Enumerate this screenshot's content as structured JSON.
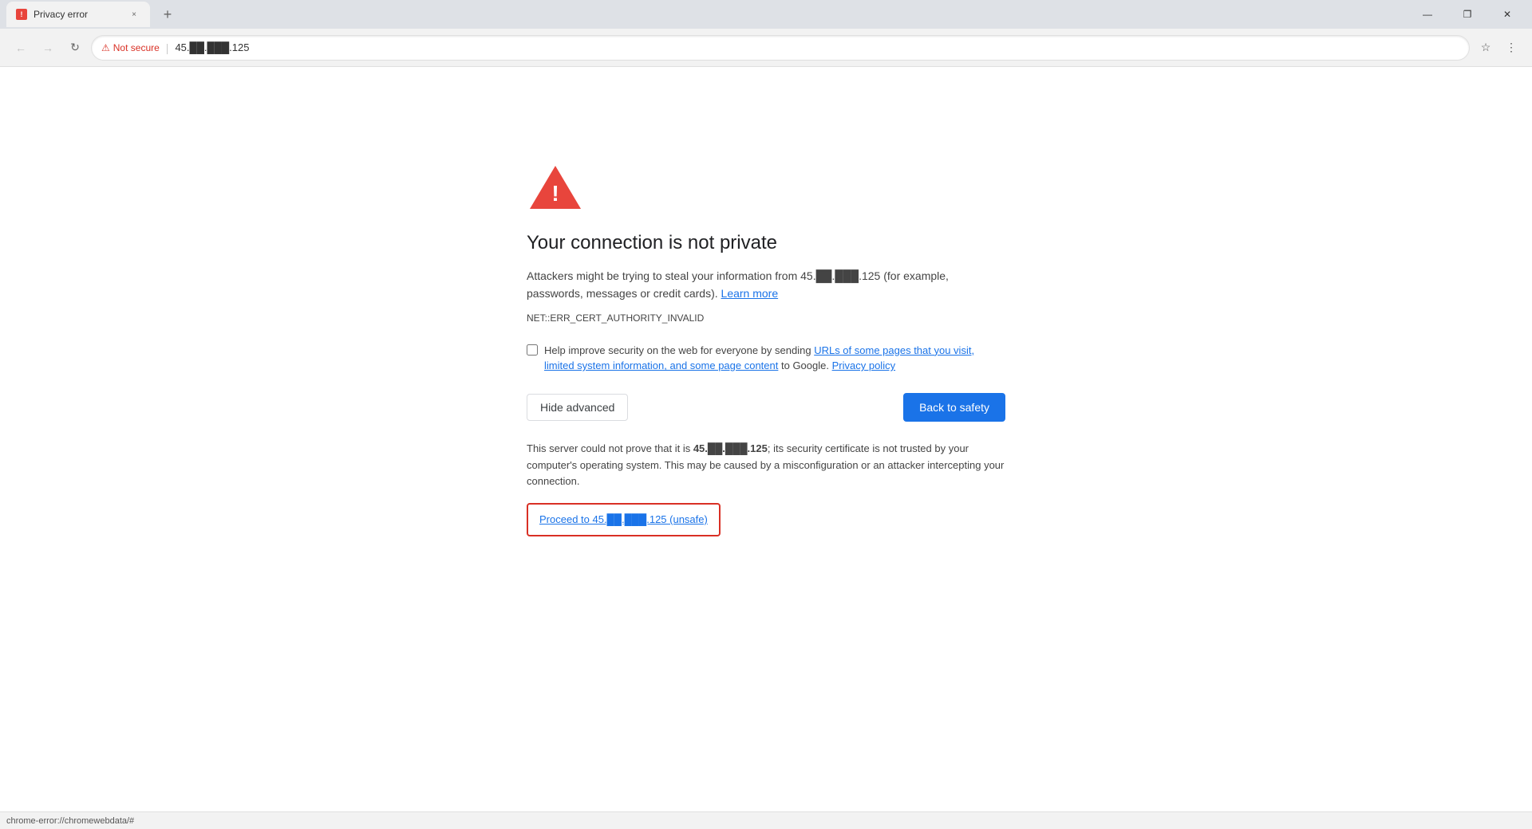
{
  "browser": {
    "tab": {
      "favicon_symbol": "!",
      "label": "Privacy error",
      "close_symbol": "×"
    },
    "new_tab_symbol": "+",
    "window_controls": {
      "minimize": "—",
      "maximize": "❐",
      "close": "✕"
    },
    "toolbar": {
      "back_symbol": "←",
      "forward_symbol": "→",
      "reload_symbol": "↻",
      "not_secure_label": "Not secure",
      "address_separator": "|",
      "address": "45.██.███.125",
      "star_symbol": "☆",
      "menu_symbol": "⋮"
    }
  },
  "error_page": {
    "icon_symbol": "!",
    "title": "Your connection is not private",
    "description_part1": "Attackers might be trying to steal your information from ",
    "ip_address": "45.██.███.125",
    "description_part2": " (for example, passwords, messages or credit cards).",
    "learn_more_link": "Learn more",
    "error_code": "NET::ERR_CERT_AUTHORITY_INVALID",
    "checkbox_label_before_link": "Help improve security on the web for everyone by sending ",
    "checkbox_link1": "URLs of some pages that you visit, limited system information, and some page content",
    "checkbox_label_after_link": " to Google.",
    "checkbox_privacy_link": "Privacy policy",
    "btn_hide_advanced": "Hide advanced",
    "btn_back_to_safety": "Back to safety",
    "server_description_part1": "This server could not prove that it is ",
    "server_ip": "45.██.███.125",
    "server_description_part2": "; its security certificate is not trusted by your computer's operating system. This may be caused by a misconfiguration or an attacker intercepting your connection.",
    "proceed_link": "Proceed to 45.██.███.125 (unsafe)"
  },
  "status_bar": {
    "text": "chrome-error://chromewebdata/#"
  }
}
